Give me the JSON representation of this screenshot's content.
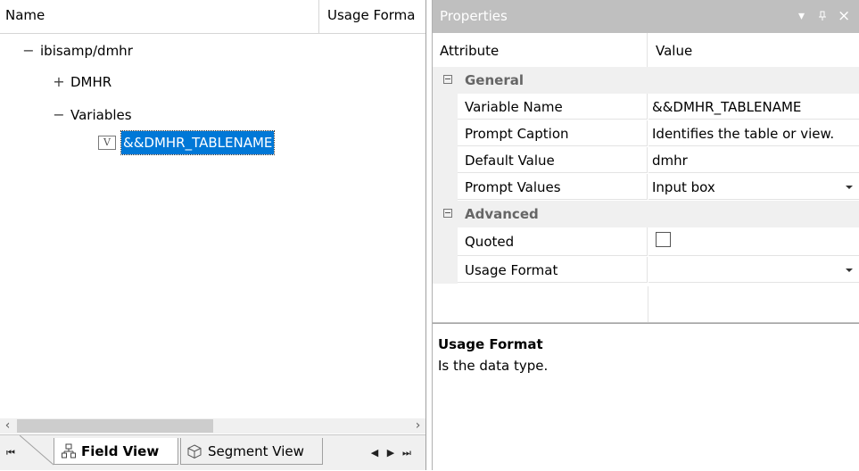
{
  "tree": {
    "columns": {
      "name": "Name",
      "usage_format": "Usage Forma"
    },
    "root": {
      "label": "ibisamp/dmhr",
      "toggle": "−"
    },
    "dmhr": {
      "label": "DMHR",
      "toggle": "+"
    },
    "variables": {
      "label": "Variables",
      "toggle": "−"
    },
    "variable_item": {
      "badge": "V",
      "label": "&&DMHR_TABLENAME"
    }
  },
  "scrollbar": {
    "left_arrow": "‹",
    "right_arrow": "›"
  },
  "tabs": {
    "first": "⏮",
    "field_view": "Field View",
    "segment_view": "Segment View",
    "prev": "◀",
    "next": "▶",
    "last": "⏭"
  },
  "properties": {
    "title": "Properties",
    "title_icons": {
      "menu": "▾",
      "pin": "ᵖ",
      "close": "×"
    },
    "grid_header": {
      "attribute": "Attribute",
      "value": "Value"
    },
    "general": {
      "label": "General",
      "rows": [
        {
          "name": "Variable Name",
          "value": "&&DMHR_TABLENAME"
        },
        {
          "name": "Prompt Caption",
          "value": "Identifies the table or view."
        },
        {
          "name": "Default Value",
          "value": "dmhr"
        },
        {
          "name": "Prompt Values",
          "value": "Input box"
        }
      ]
    },
    "advanced": {
      "label": "Advanced",
      "rows": [
        {
          "name": "Quoted",
          "value": ""
        },
        {
          "name": "Usage Format",
          "value": ""
        }
      ]
    },
    "help": {
      "title": "Usage Format",
      "description": "Is the data type."
    }
  },
  "icons": {
    "field_view": "hierarchy-icon",
    "segment_view": "cube-icon",
    "collapse": "minus-box-icon",
    "dropdown": "chevron-down-icon"
  }
}
